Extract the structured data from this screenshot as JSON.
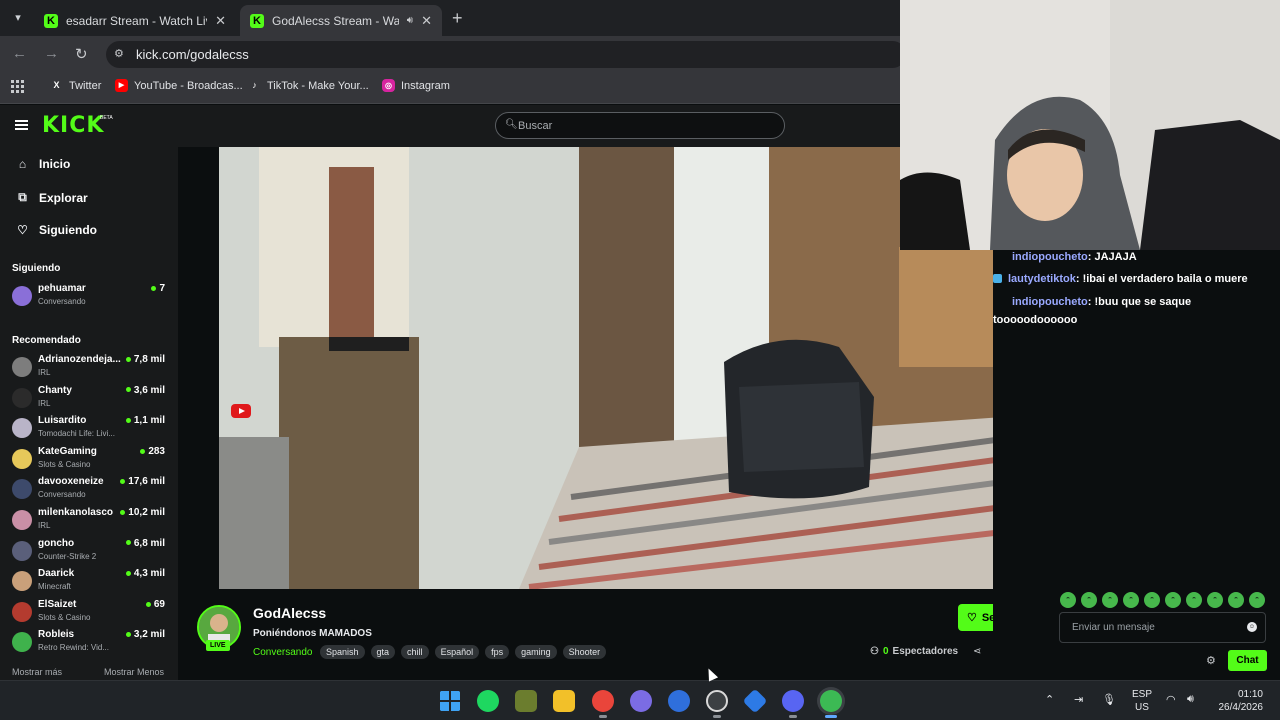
{
  "browser": {
    "tabs": [
      {
        "title": "esadarr Stream - Watch Live on",
        "active": false
      },
      {
        "title": "GodAlecss Stream - Watch",
        "active": true
      }
    ],
    "url": "kick.com/godalecss",
    "bookmarks": [
      {
        "label": "Twitter",
        "icon": "x-icon"
      },
      {
        "label": "YouTube - Broadcas...",
        "icon": "youtube-icon"
      },
      {
        "label": "TikTok - Make Your...",
        "icon": "tiktok-icon"
      },
      {
        "label": "Instagram",
        "icon": "instagram-icon"
      }
    ]
  },
  "kick": {
    "logo": "KICK",
    "beta": "BETA",
    "search_placeholder": "Buscar",
    "nav": [
      {
        "label": "Inicio",
        "icon": "home-icon"
      },
      {
        "label": "Explorar",
        "icon": "compass-icon"
      },
      {
        "label": "Siguiendo",
        "icon": "heart-icon"
      }
    ],
    "following_title": "Siguiendo",
    "following": [
      {
        "name": "pehuamar",
        "category": "Conversando",
        "count": "7",
        "color": "#8a6fd8"
      }
    ],
    "recommended_title": "Recomendado",
    "recommended": [
      {
        "name": "Adrianozendeja...",
        "category": "IRL",
        "count": "7,8 mil",
        "color": "#7d7d7d"
      },
      {
        "name": "Chanty",
        "category": "IRL",
        "count": "3,6 mil",
        "color": "#2b2b2b"
      },
      {
        "name": "Luisardito",
        "category": "Tomodachi Life: Livi...",
        "count": "1,1 mil",
        "color": "#b9b4c8"
      },
      {
        "name": "KateGaming",
        "category": "Slots & Casino",
        "count": "283",
        "color": "#e6c85a"
      },
      {
        "name": "davooxeneize",
        "category": "Conversando",
        "count": "17,6 mil",
        "color": "#3d4a6b"
      },
      {
        "name": "milenkanolasco",
        "category": "IRL",
        "count": "10,2 mil",
        "color": "#c98fa6"
      },
      {
        "name": "goncho",
        "category": "Counter-Strike 2",
        "count": "6,8 mil",
        "color": "#5a5f7a"
      },
      {
        "name": "Daarick",
        "category": "Minecraft",
        "count": "4,3 mil",
        "color": "#c9a07a"
      },
      {
        "name": "ElSaizet",
        "category": "Slots & Casino",
        "count": "69",
        "color": "#b43b2f"
      },
      {
        "name": "Robleis",
        "category": "Retro Rewind: Vid...",
        "count": "3,2 mil",
        "color": "#3fb24c"
      }
    ],
    "show_more": "Mostrar más",
    "show_less": "Mostrar Menos"
  },
  "stream": {
    "streamer": "GodAlecss",
    "title": "Poniéndonos MAMADOS",
    "category": "Conversando",
    "live_label": "LIVE",
    "tags": [
      "Spanish",
      "gta",
      "chill",
      "Español",
      "fps",
      "gaming",
      "Shooter"
    ],
    "follow_label": "Seguir",
    "viewers_count": "0",
    "viewers_label": "Espectadores"
  },
  "chat": {
    "messages": [
      {
        "user": "indiopoucheto",
        "text": ": JAJAJA",
        "badge": false
      },
      {
        "user": "lautydetiktok",
        "text": ": !ibai el verdadero baila o muere",
        "badge": true
      },
      {
        "user": "indiopoucheto",
        "text": ": !buu que se saque tooooodoooooo",
        "badge": false
      }
    ],
    "input_placeholder": "Enviar un mensaje",
    "chat_button": "Chat"
  },
  "taskbar": {
    "lang_top": "ESP",
    "lang_bottom": "US",
    "time": "01:10",
    "date": "26/4/2026"
  },
  "colors": {
    "accent": "#53fc18",
    "chat_user": "#9aa9ff",
    "background": "#0b0e0f"
  }
}
